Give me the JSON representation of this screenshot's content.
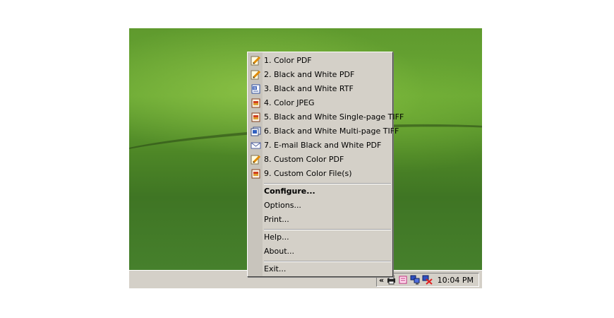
{
  "menu": {
    "items": [
      {
        "label": "1. Color PDF",
        "icon": "pdf-pencil-icon"
      },
      {
        "label": "2. Black and White PDF",
        "icon": "pdf-pencil-icon"
      },
      {
        "label": "3. Black and White RTF",
        "icon": "word-document-icon"
      },
      {
        "label": "4. Color JPEG",
        "icon": "image-file-icon"
      },
      {
        "label": "5. Black and White Single-page TIFF",
        "icon": "image-file-icon"
      },
      {
        "label": "6. Black and White Multi-page TIFF",
        "icon": "multipage-image-icon"
      },
      {
        "label": "7. E-mail Black and White PDF",
        "icon": "envelope-icon"
      },
      {
        "label": "8. Custom Color PDF",
        "icon": "pdf-pencil-icon"
      },
      {
        "label": "9. Custom Color File(s)",
        "icon": "image-file-icon"
      }
    ],
    "configure": "Configure...",
    "options": "Options...",
    "print": "Print...",
    "help": "Help...",
    "about": "About...",
    "exit": "Exit..."
  },
  "taskbar": {
    "chevron": "«",
    "tray_icons": [
      "printer-tray-icon",
      "notes-tray-icon",
      "network-computers-icon",
      "network-disconnected-icon"
    ],
    "clock": "10:04 PM"
  }
}
